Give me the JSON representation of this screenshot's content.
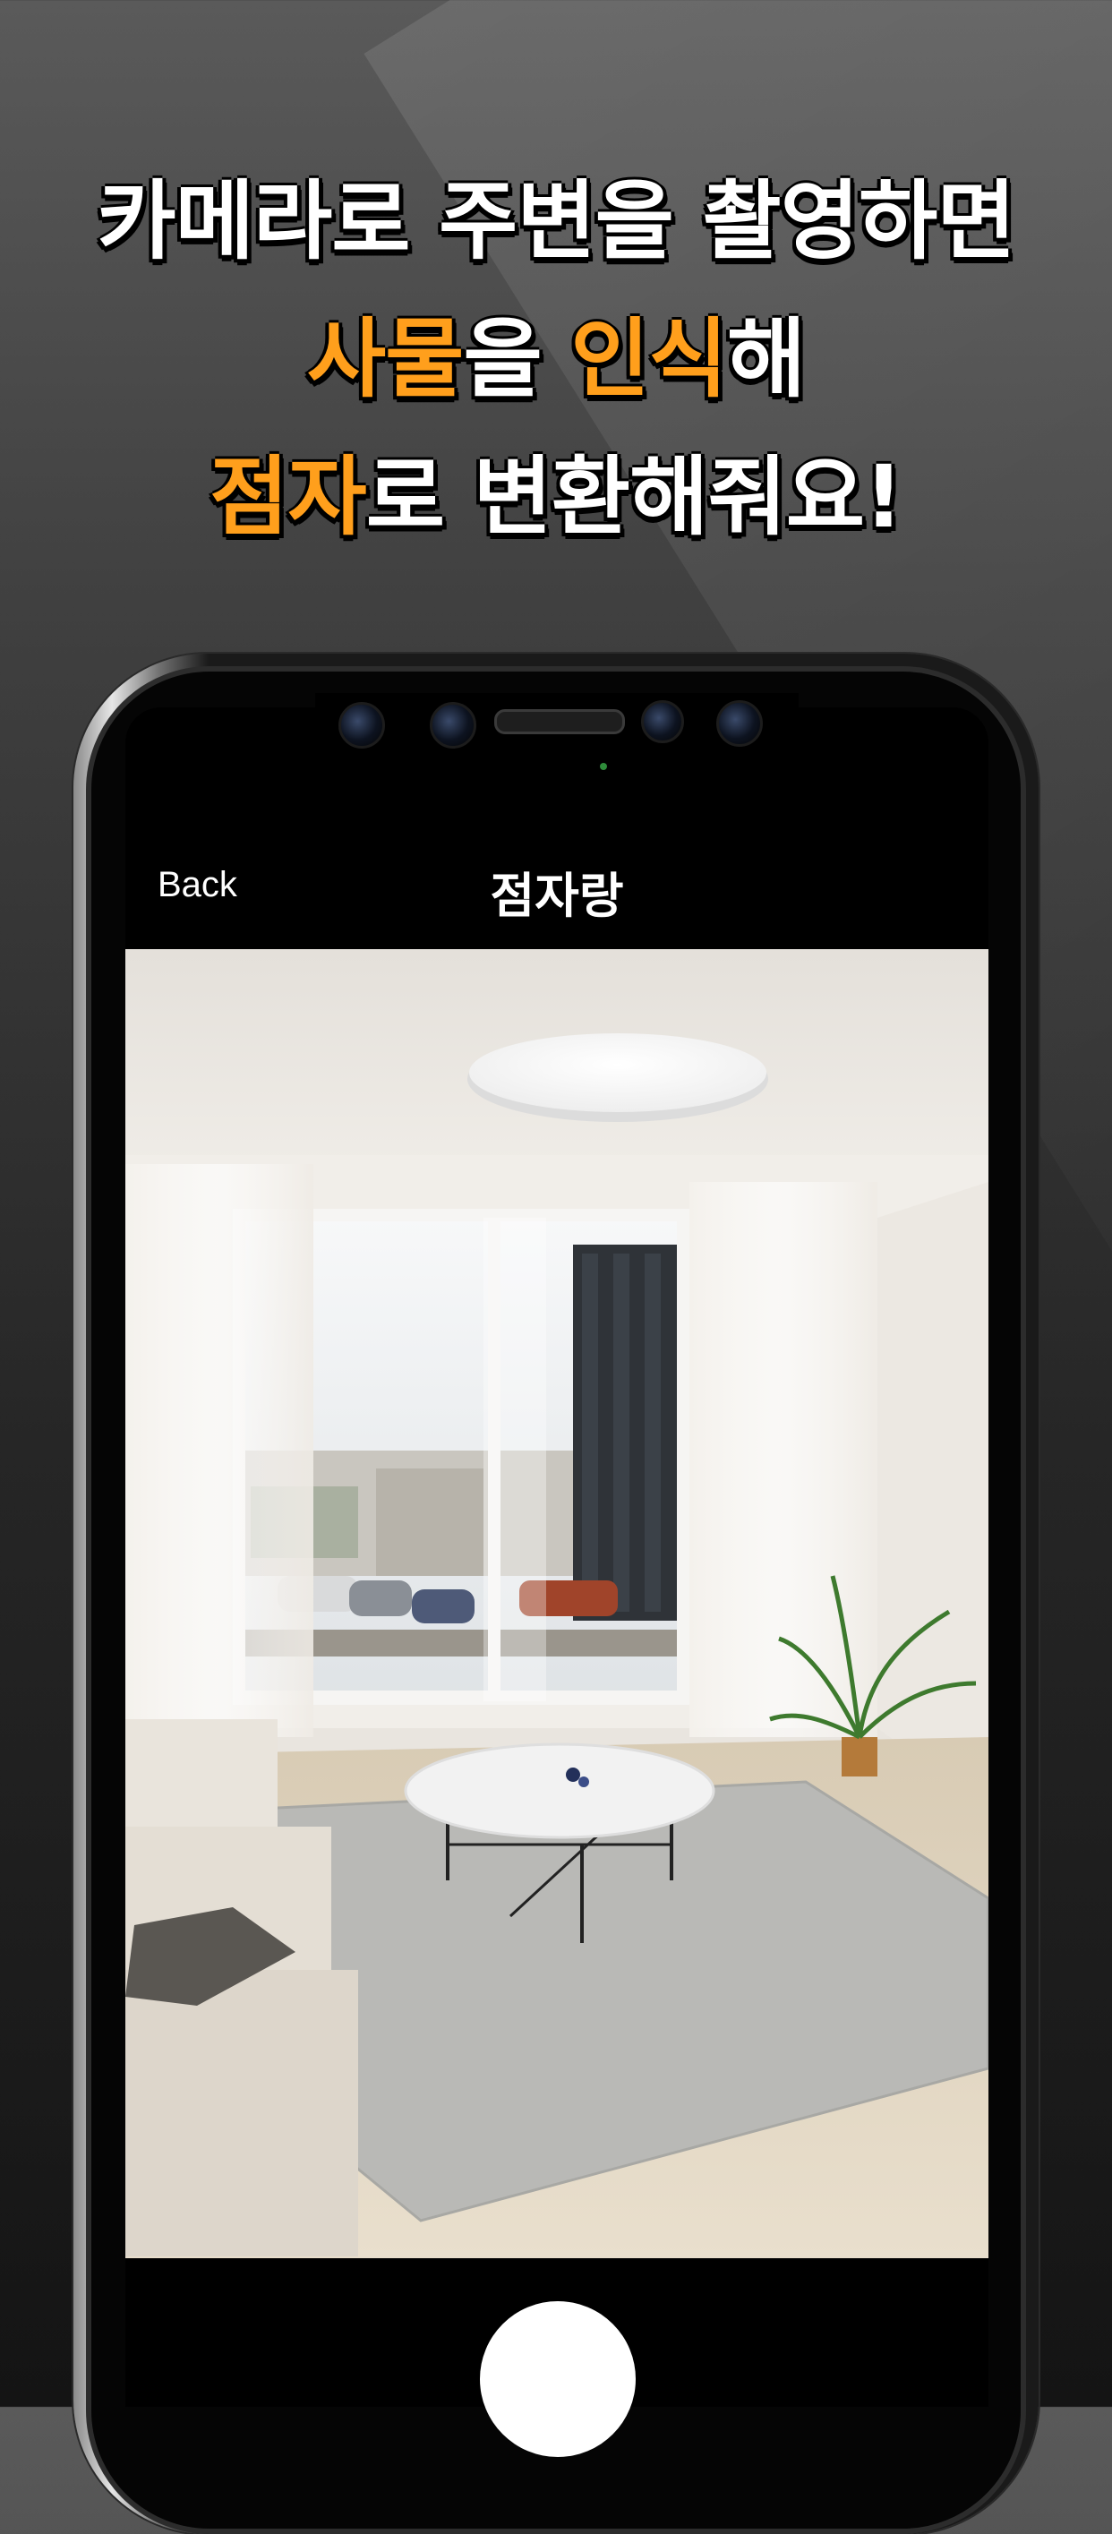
{
  "headline": {
    "line1": "카메라로 주변을 촬영하면",
    "line2_highlight_a": "사물",
    "line2_part_b": "을 ",
    "line2_highlight_c": "인식",
    "line2_part_d": "해",
    "line3_highlight": "점자",
    "line3_rest": "로 변환해줘요!"
  },
  "colors": {
    "highlight": "#ff9f1c",
    "text": "#ffffff",
    "background": "#3a3a3a"
  },
  "nav": {
    "back_label": "Back",
    "title": "점자랑"
  },
  "camera": {
    "scene": "living-room-photo"
  },
  "icons": {
    "shutter": "shutter-button-icon"
  }
}
